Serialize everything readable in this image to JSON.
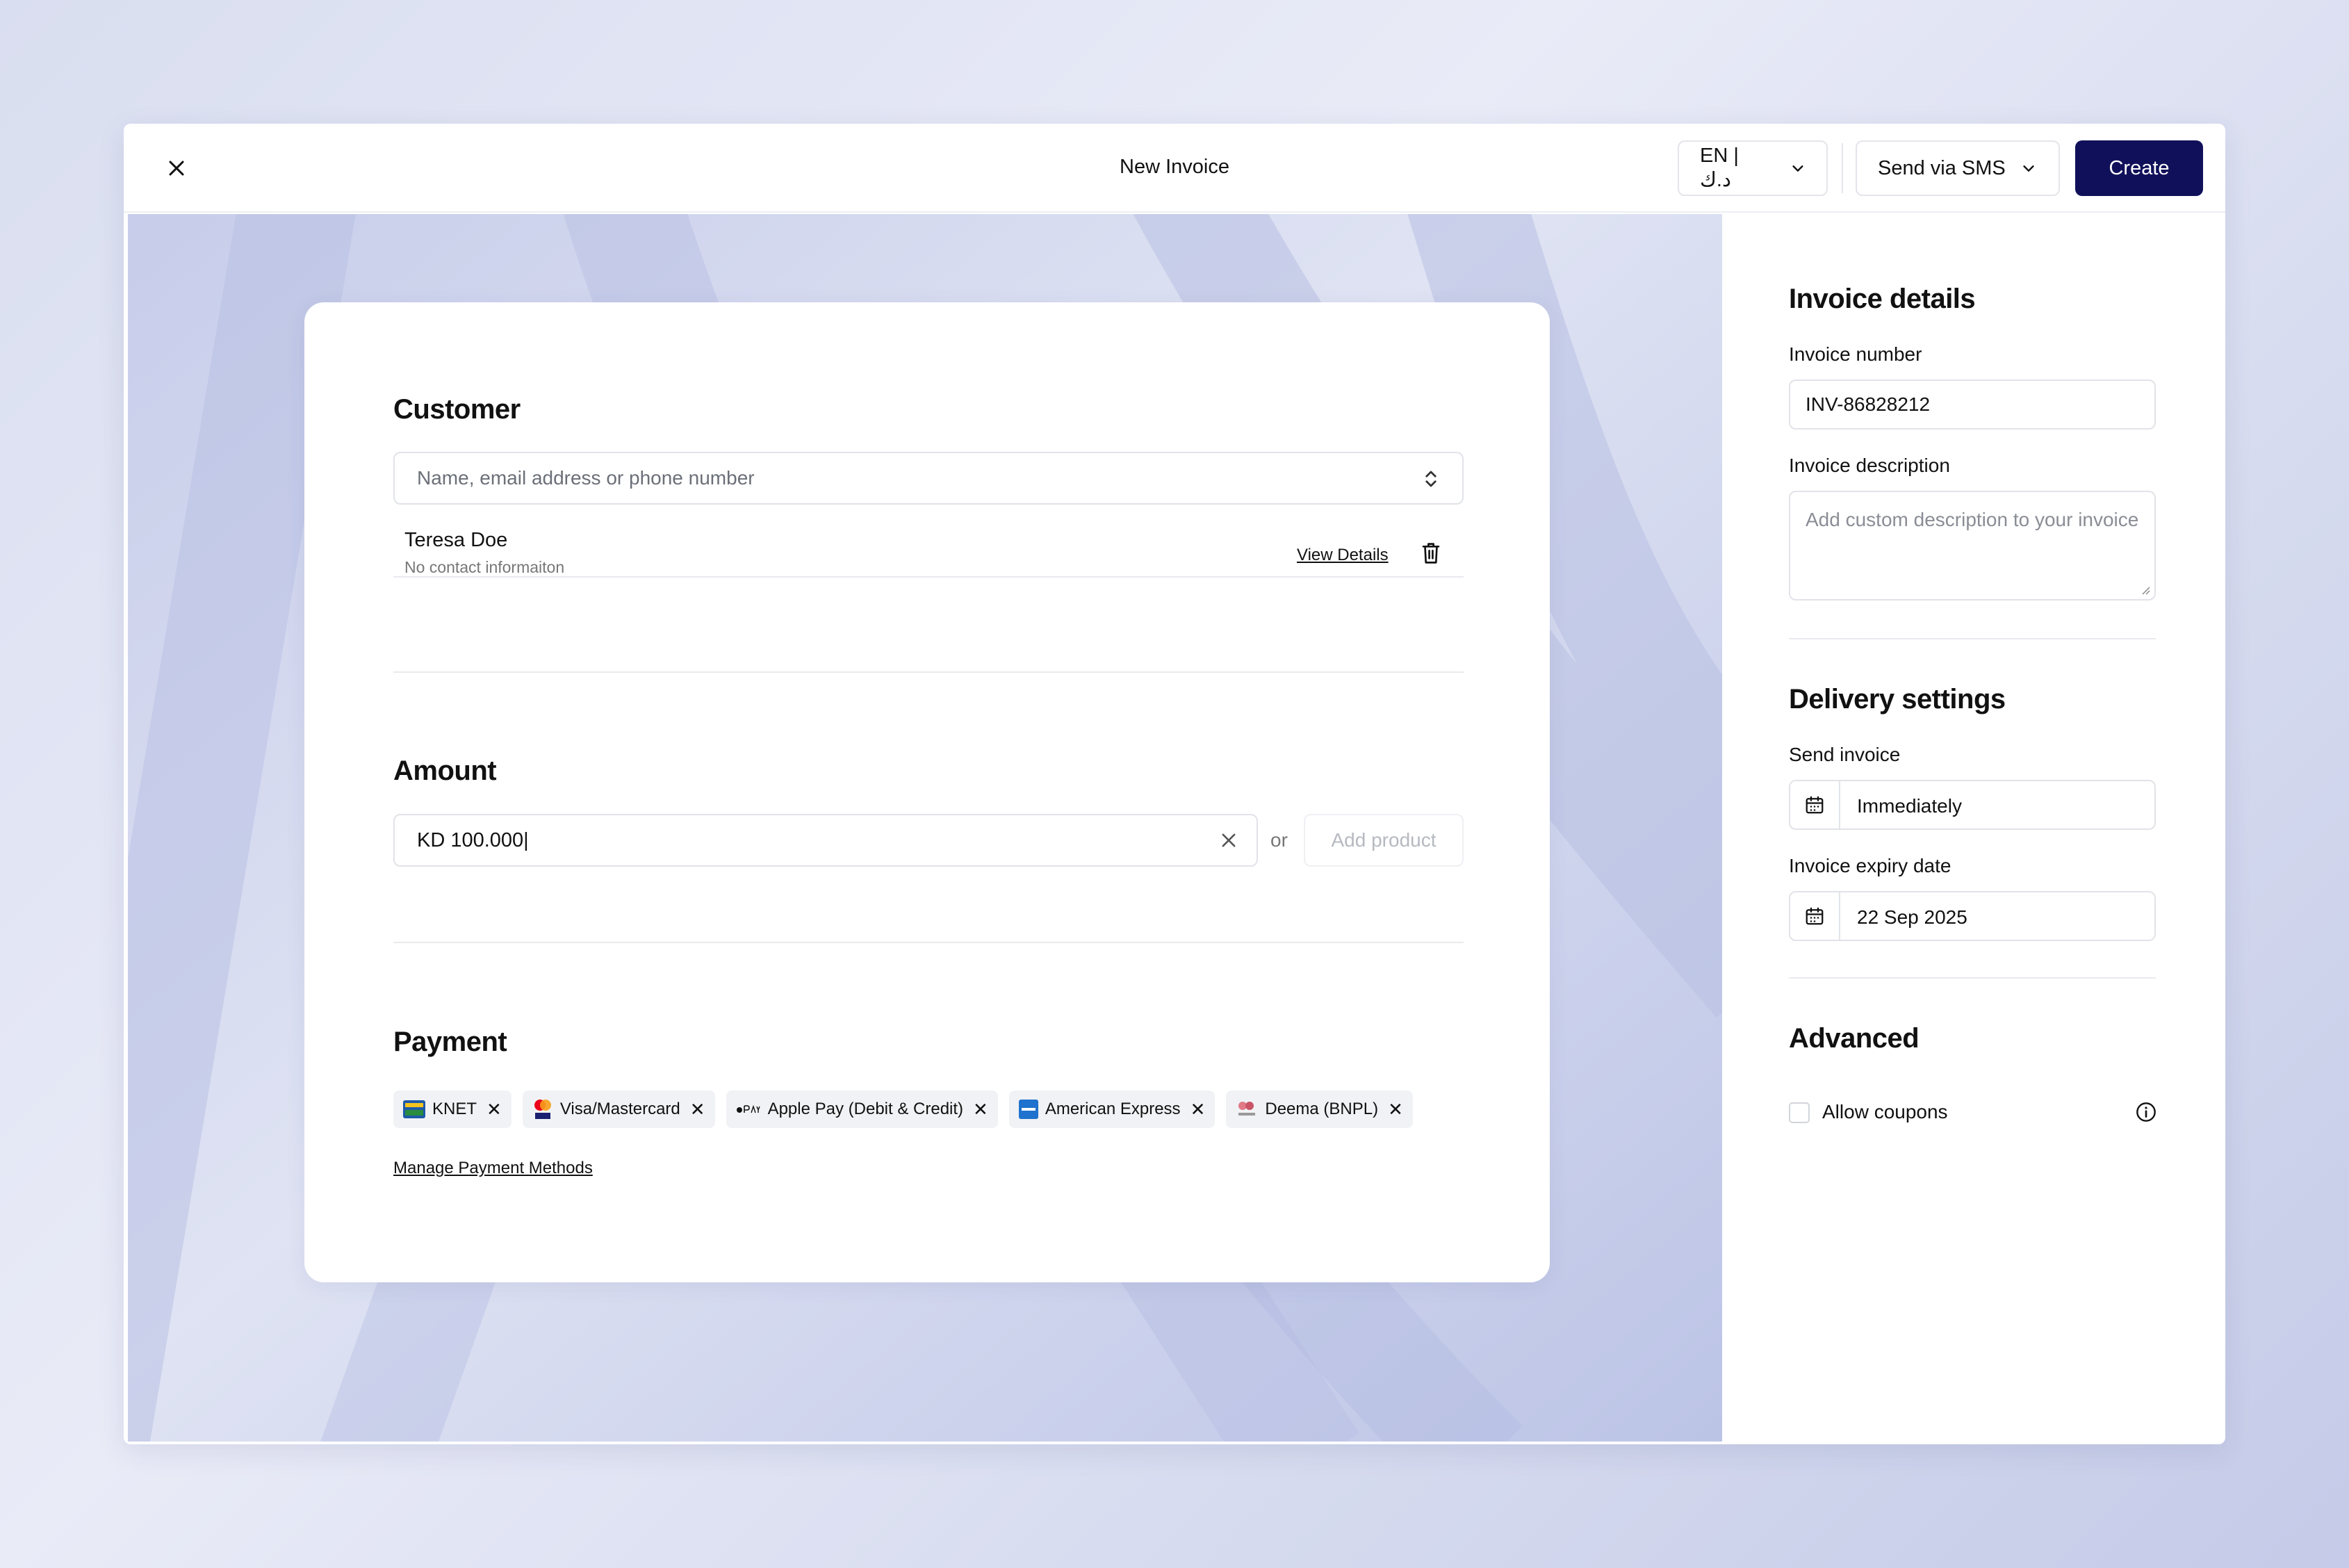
{
  "header": {
    "title": "New Invoice",
    "language_label": "EN | د.ك",
    "send_label": "Send via SMS",
    "create_label": "Create"
  },
  "customer": {
    "title": "Customer",
    "search_placeholder": "Name, email address or phone number",
    "selected": {
      "name": "Teresa Doe",
      "contact": "No contact informaiton",
      "view_details": "View Details"
    }
  },
  "amount": {
    "title": "Amount",
    "value": "KD 100.000|",
    "or_label": "or",
    "add_product": "Add product"
  },
  "payment": {
    "title": "Payment",
    "methods": [
      {
        "label": "KNET",
        "icon": "knet-icon"
      },
      {
        "label": "Visa/Mastercard",
        "icon": "mastercard-icon"
      },
      {
        "label": "Apple Pay (Debit & Credit)",
        "icon": "apple-pay-icon"
      },
      {
        "label": "American Express",
        "icon": "amex-icon"
      },
      {
        "label": "Deema (BNPL)",
        "icon": "deema-icon"
      }
    ],
    "manage_link": "Manage Payment Methods"
  },
  "sidebar": {
    "invoice_details_title": "Invoice details",
    "invoice_number_label": "Invoice number",
    "invoice_number_value": "INV-86828212",
    "invoice_description_label": "Invoice description",
    "invoice_description_placeholder": "Add custom description to your invoice",
    "delivery_title": "Delivery settings",
    "send_invoice_label": "Send invoice",
    "send_invoice_value": "Immediately",
    "expiry_label": "Invoice expiry date",
    "expiry_value": "22 Sep 2025",
    "advanced_title": "Advanced",
    "allow_coupons_label": "Allow coupons"
  },
  "colors": {
    "primary": "#10105a",
    "border": "#e1e3e8",
    "chip_bg": "#f1f2f5"
  }
}
